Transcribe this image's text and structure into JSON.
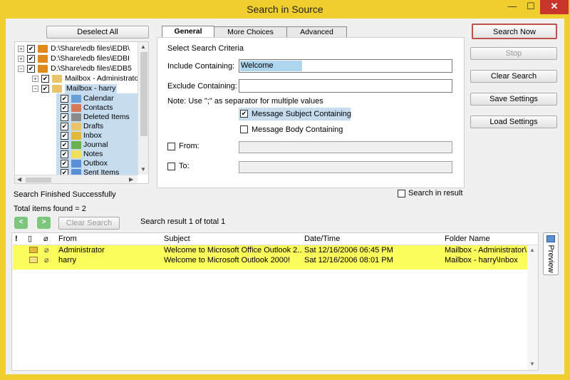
{
  "window": {
    "title": "Search in Source"
  },
  "titlebar": {
    "minimize": "—",
    "maximize": "☐",
    "close": "✕"
  },
  "left": {
    "deselect_all": "Deselect All",
    "tree": [
      {
        "label": "D:\\Share\\edb files\\EDB\\"
      },
      {
        "label": "D:\\Share\\edb files\\EDBI"
      },
      {
        "label": "D:\\Share\\edb files\\EDB5"
      },
      {
        "label": "Mailbox - Administrator"
      },
      {
        "label": "Mailbox - harry"
      },
      {
        "label": "Calendar"
      },
      {
        "label": "Contacts"
      },
      {
        "label": "Deleted Items"
      },
      {
        "label": "Drafts"
      },
      {
        "label": "Inbox"
      },
      {
        "label": "Journal"
      },
      {
        "label": "Notes"
      },
      {
        "label": "Outbox"
      },
      {
        "label": "Sent Items"
      }
    ]
  },
  "tabs": [
    "General",
    "More Choices",
    "Advanced"
  ],
  "criteria": {
    "heading": "Select Search Criteria",
    "include_label": "Include Containing:",
    "include_value": "Welcome",
    "exclude_label": "Exclude Containing:",
    "exclude_value": "",
    "note": "Note: Use \";\" as separator for multiple values",
    "subject_label": "Message Subject Containing",
    "body_label": "Message Body Containing",
    "from_label": "From:",
    "to_label": "To:"
  },
  "actions": {
    "search_now": "Search Now",
    "stop": "Stop",
    "clear_search": "Clear Search",
    "save_settings": "Save Settings",
    "load_settings": "Load Settings"
  },
  "status": {
    "finished": "Search Finished Successfully",
    "total_items": "Total items found = 2",
    "search_in_result": "Search in result",
    "clear_search": "Clear Search",
    "result_info": "Search result 1 of total 1"
  },
  "results": {
    "columns": {
      "from": "From",
      "subject": "Subject",
      "datetime": "Date/Time",
      "folder": "Folder Name"
    },
    "rows": [
      {
        "from": "Administrator",
        "subject": "Welcome to Microsoft Office Outlook 2...",
        "datetime": "Sat 12/16/2006 06:45 PM",
        "folder": "Mailbox - Administrator\\Inbox"
      },
      {
        "from": "harry",
        "subject": "Welcome to Microsoft Outlook 2000!",
        "datetime": "Sat 12/16/2006 08:01 PM",
        "folder": "Mailbox - harry\\Inbox"
      }
    ],
    "preview": "Preview"
  },
  "colors": {
    "frame": "#f0ce2e",
    "row_highlight": "#fcfc5c",
    "selection": "#c6dcef",
    "accent": "#c0504d"
  }
}
